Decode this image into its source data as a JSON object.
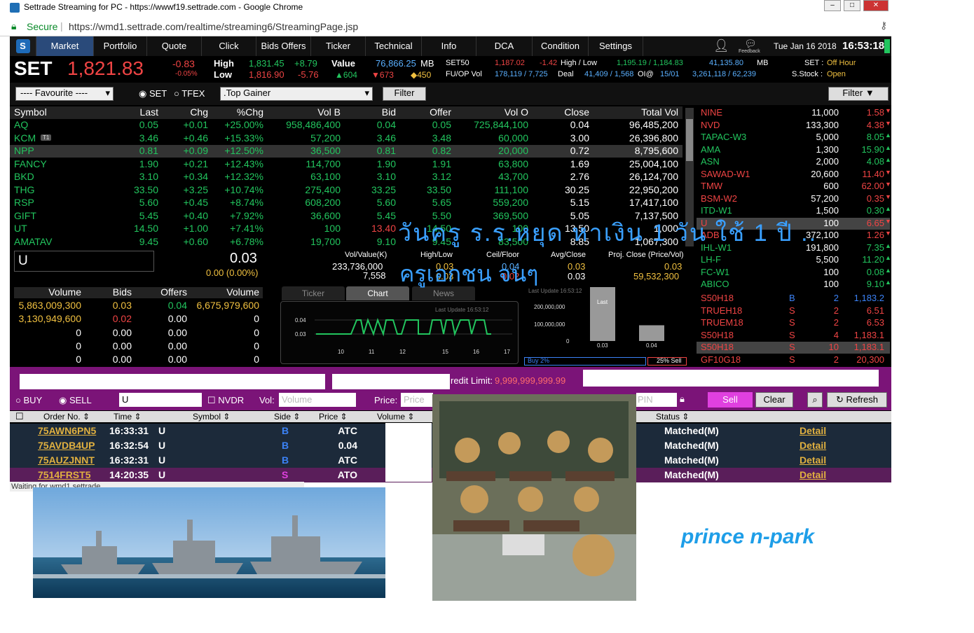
{
  "browser": {
    "title": "Settrade Streaming for PC - https://wwwf19.settrade.com - Google Chrome",
    "secure": "Secure",
    "url": "https://wmd1.settrade.com/realtime/streaming6/StreamingPage.jsp"
  },
  "nav": {
    "tabs": [
      "Market",
      "Portfolio",
      "Quote",
      "Click",
      "Bids Offers",
      "Ticker",
      "Technical",
      "Info",
      "DCA",
      "Condition",
      "Settings"
    ],
    "feedback": "Feedback",
    "date": "Tue Jan 16 2018",
    "time": "16:53:18"
  },
  "index": {
    "name": "SET",
    "value": "1,821.83",
    "chg": "-0.83",
    "pct": "-0.05%",
    "high_label": "High",
    "high": "1,831.45",
    "high_chg": "+8.79",
    "low_label": "Low",
    "low": "1,816.90",
    "low_chg": "-5.76",
    "value_label": "Value",
    "value_mb": "76,866.25",
    "mb": "MB",
    "up": "604",
    "down": "673",
    "unch": "450",
    "set50": "SET50",
    "set50_val": "1,187.02",
    "set50_chg": "-1.42",
    "hl_label": "High / Low",
    "hl": "1,195.19 / 1,184.83",
    "mb2": "41,135.80",
    "mb2_unit": "MB",
    "set_status_label": "SET :",
    "set_status": "Off Hour",
    "fuop": "FU/OP Vol",
    "fuop_val": "178,119 / 7,725",
    "deal_label": "Deal",
    "deal": "41,409 / 1,568",
    "oi_label": "OI@",
    "oi_date": "15/01",
    "oi_val": "3,261,118 / 62,239",
    "sstock_label": "S.Stock :",
    "sstock": "Open"
  },
  "filters": {
    "favourite": "---- Favourite ----",
    "set": "SET",
    "tfex": "TFEX",
    "list": ".Top Gainer",
    "filter": "Filter",
    "filter2": "Filter"
  },
  "table": {
    "headers": [
      "Symbol",
      "Last",
      "Chg",
      "%Chg",
      "Vol B",
      "Bid",
      "Offer",
      "Vol O",
      "Close",
      "Total Vol"
    ],
    "rows": [
      [
        "AQ",
        "0.05",
        "+0.01",
        "+25.00%",
        "958,486,400",
        "0.04",
        "0.05",
        "725,844,100",
        "0.04",
        "96,485,200"
      ],
      [
        "KCM",
        "3.46",
        "+0.46",
        "+15.33%",
        "57,200",
        "3.46",
        "3.48",
        "60,000",
        "3.00",
        "26,396,800"
      ],
      [
        "NPP",
        "0.81",
        "+0.09",
        "+12.50%",
        "36,500",
        "0.81",
        "0.82",
        "20,000",
        "0.72",
        "8,795,600"
      ],
      [
        "FANCY",
        "1.90",
        "+0.21",
        "+12.43%",
        "114,700",
        "1.90",
        "1.91",
        "63,800",
        "1.69",
        "25,004,100"
      ],
      [
        "BKD",
        "3.10",
        "+0.34",
        "+12.32%",
        "63,100",
        "3.10",
        "3.12",
        "43,700",
        "2.76",
        "26,124,700"
      ],
      [
        "THG",
        "33.50",
        "+3.25",
        "+10.74%",
        "275,400",
        "33.25",
        "33.50",
        "111,100",
        "30.25",
        "22,950,200"
      ],
      [
        "RSP",
        "5.60",
        "+0.45",
        "+8.74%",
        "608,200",
        "5.60",
        "5.65",
        "559,200",
        "5.15",
        "17,417,100"
      ],
      [
        "GIFT",
        "5.45",
        "+0.40",
        "+7.92%",
        "36,600",
        "5.45",
        "5.50",
        "369,500",
        "5.05",
        "7,137,500"
      ],
      [
        "UT",
        "14.50",
        "+1.00",
        "+7.41%",
        "100",
        "13.40",
        "14.50",
        "100",
        "13.50",
        "1,000"
      ],
      [
        "AMATAV",
        "9.45",
        "+0.60",
        "+6.78%",
        "19,700",
        "9.10",
        "9.45",
        "83,500",
        "8.85",
        "1,067,300"
      ]
    ],
    "kcm_badge": "T1"
  },
  "quote": {
    "symbol": "U",
    "last": "0.03",
    "chg": "0.00 (0.00%)",
    "volval_label": "Vol/Value(K)",
    "vol": "233,736,000",
    "val": "7,558",
    "hl_label": "High/Low",
    "high": "0.03",
    "low": "0.03",
    "cf_label": "Ceil/Floor",
    "ceil": "0.04",
    "floor": "0.02",
    "avg_label": "Avg/Close",
    "avg": "0.03",
    "close": "0.03",
    "proj_label": "Proj. Close (Price/Vol)",
    "proj_price": "0.03",
    "proj_vol": "59,532,300"
  },
  "bidoffer": {
    "headers": [
      "Volume",
      "Bids",
      "Offers",
      "Volume"
    ],
    "rows": [
      [
        "5,863,009,300",
        "0.03",
        "0.04",
        "6,675,979,600"
      ],
      [
        "3,130,949,600",
        "0.02",
        "0.00",
        "0"
      ],
      [
        "0",
        "0.00",
        "0.00",
        "0"
      ],
      [
        "0",
        "0.00",
        "0.00",
        "0"
      ],
      [
        "0",
        "0.00",
        "0.00",
        "0"
      ]
    ]
  },
  "chart_tabs": [
    "Ticker",
    "Chart",
    "News"
  ],
  "chart_data": [
    {
      "type": "line",
      "title": "Last Update 16:53:12",
      "x": [
        "10",
        "11",
        "12",
        "15",
        "16",
        "17"
      ],
      "yticks": [
        "0.04",
        "0.03"
      ],
      "ylim": [
        0.025,
        0.045
      ]
    },
    {
      "type": "bar",
      "title": "Last Update 16:53:12",
      "categories": [
        "0.03",
        "0.04"
      ],
      "yticks": [
        "200,000,000",
        "100,000,000",
        "0"
      ],
      "last_label": "Last",
      "series": [
        {
          "values": [
            233736000,
            45000000
          ]
        }
      ]
    }
  ],
  "buysell": {
    "buy": "Buy 2%",
    "sell": "25% Sell"
  },
  "ticker_right": [
    [
      "NINE",
      "11,000",
      "1.58"
    ],
    [
      "NVD",
      "133,300",
      "4.38"
    ],
    [
      "TAPAC-W3",
      "5,000",
      "8.05"
    ],
    [
      "AMA",
      "1,300",
      "15.90"
    ],
    [
      "ASN",
      "2,000",
      "4.08"
    ],
    [
      "SAWAD-W1",
      "20,600",
      "11.40"
    ],
    [
      "TMW",
      "600",
      "62.00"
    ],
    [
      "BSM-W2",
      "57,200",
      "0.35"
    ],
    [
      "ITD-W1",
      "1,500",
      "0.30"
    ],
    [
      "U",
      "100",
      "6.65"
    ],
    [
      "ADB",
      "372,100",
      "1.26"
    ],
    [
      "IHL-W1",
      "191,800",
      "7.35"
    ],
    [
      "LH-F",
      "5,500",
      "11.20"
    ],
    [
      "FC-W1",
      "100",
      "0.08"
    ],
    [
      "ABICO",
      "100",
      "9.10"
    ]
  ],
  "ticker_right_tfex": [
    [
      "S50H18",
      "B",
      "2",
      "1,183.2"
    ],
    [
      "TRUEH18",
      "S",
      "2",
      "6.51"
    ],
    [
      "TRUEM18",
      "S",
      "2",
      "6.53"
    ],
    [
      "S50H18",
      "S",
      "4",
      "1,183.1"
    ],
    [
      "S50H18",
      "S",
      "10",
      "1,183.1"
    ],
    [
      "GF10G18",
      "S",
      "2",
      "20,300"
    ]
  ],
  "order": {
    "credit": "redit Limit:",
    "credit_val": "9,999,999,999.99",
    "buy": "BUY",
    "sell": "SELL",
    "symbol": "U",
    "nvdr": "NVDR",
    "vol_label": "Vol:",
    "vol_ph": "Volume",
    "price_label": "Price:",
    "price_ph": "Price",
    "pin_ph": "PIN",
    "sell_btn": "Sell",
    "clear_btn": "Clear",
    "refresh_btn": "Refresh",
    "headers": [
      "Order No.",
      "Time",
      "Symbol",
      "Side",
      "Price",
      "Volume",
      "Status"
    ],
    "rows": [
      [
        "75AWN6PN5",
        "16:33:31",
        "U",
        "B",
        "ATC",
        "Matched(M)",
        "Detail"
      ],
      [
        "75AVDB4UP",
        "16:32:54",
        "U",
        "B",
        "0.04",
        "Matched(M)",
        "Detail"
      ],
      [
        "75AUZJNNT",
        "16:32:31",
        "U",
        "B",
        "ATC",
        "Matched(M)",
        "Detail"
      ],
      [
        "7514FRST5",
        "14:20:35",
        "U",
        "S",
        "ATO",
        "Matched(M)",
        "Detail"
      ]
    ]
  },
  "status_bar": "Waiting for wmd1.settrade...",
  "overlay": {
    "thai1": "วันครู  ร.ร.หยุด หาเงิน 1 วัน ใช้ 1 ปี ..",
    "thai2": "ครูเอกชน จนๆ",
    "signature": "prince n-park"
  }
}
